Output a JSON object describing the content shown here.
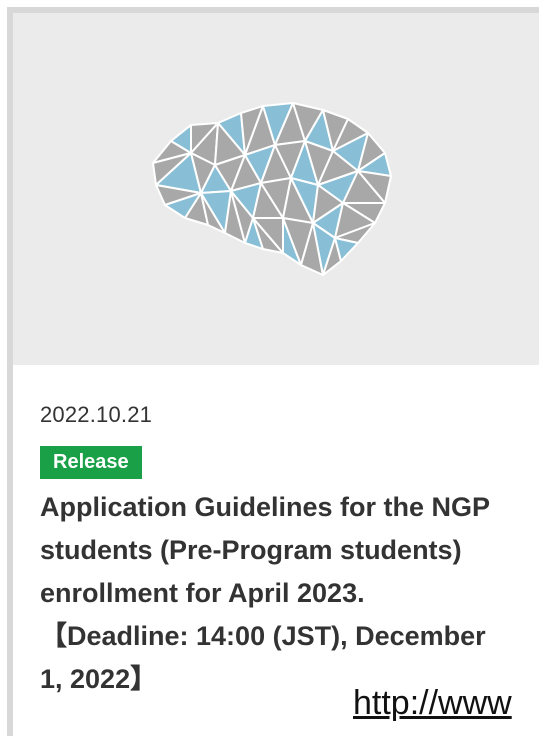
{
  "card": {
    "date": "2022.10.21",
    "category": "Release",
    "title": "Application Guidelines for the NGP students (Pre-Program students) enrollment for April 2023.【Deadline: 14:00 (JST), December 1, 2022】",
    "thumbnail_icon": "low-poly-brain-icon"
  },
  "overlay": {
    "url_text": "http://www"
  },
  "colors": {
    "thumbnail_bg": "#ebebeb",
    "badge_bg": "#1aa148",
    "brain_gray": "#a8a8a8",
    "brain_blue": "#88bfd6",
    "text": "#333333"
  }
}
